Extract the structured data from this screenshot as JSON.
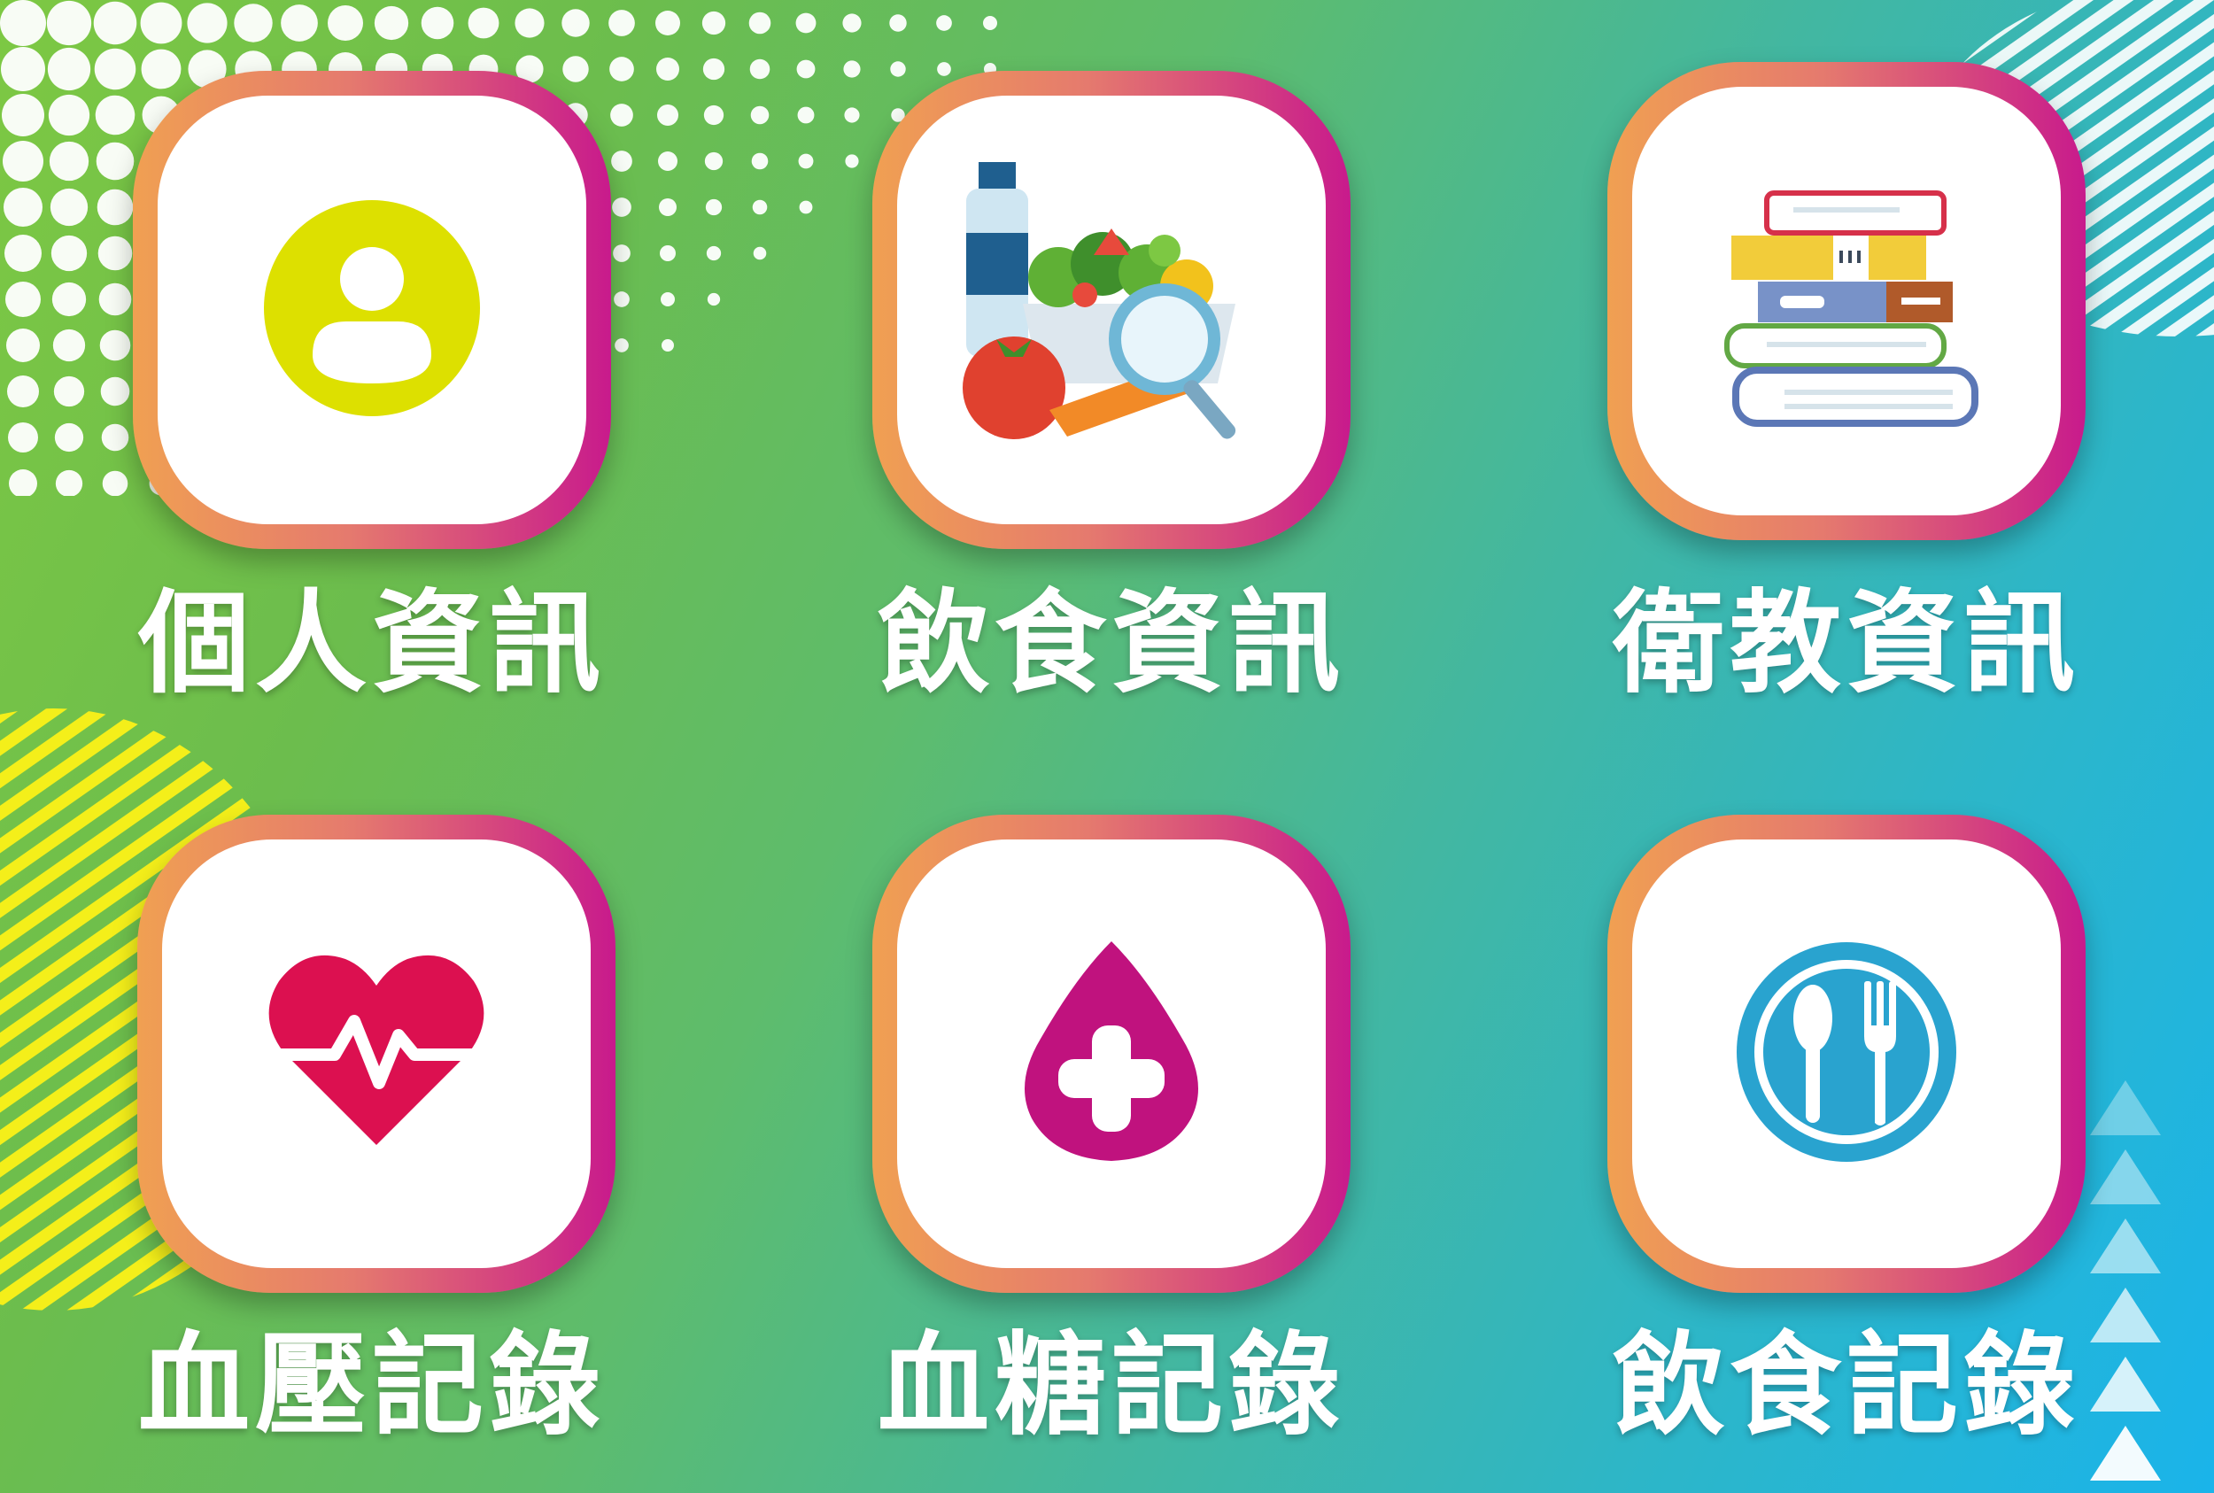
{
  "menu": {
    "items": [
      {
        "label": "個人資訊",
        "icon": "user-profile-icon"
      },
      {
        "label": "飲食資訊",
        "icon": "food-search-icon"
      },
      {
        "label": "衛教資訊",
        "icon": "books-stack-icon"
      },
      {
        "label": "血壓記錄",
        "icon": "heart-pulse-icon"
      },
      {
        "label": "血糖記錄",
        "icon": "blood-drop-plus-icon"
      },
      {
        "label": "飲食記錄",
        "icon": "spoon-fork-plate-icon"
      }
    ]
  },
  "colors": {
    "background_start": "#7dc843",
    "background_end": "#1ab4ea",
    "tile_border_start": "#f0a052",
    "tile_border_end": "#c81a8c",
    "label": "#ffffff",
    "user_icon": "#dde000",
    "heart_icon": "#dc1050",
    "drop_icon": "#c0127e",
    "plate_icon": "#29a3cf"
  }
}
